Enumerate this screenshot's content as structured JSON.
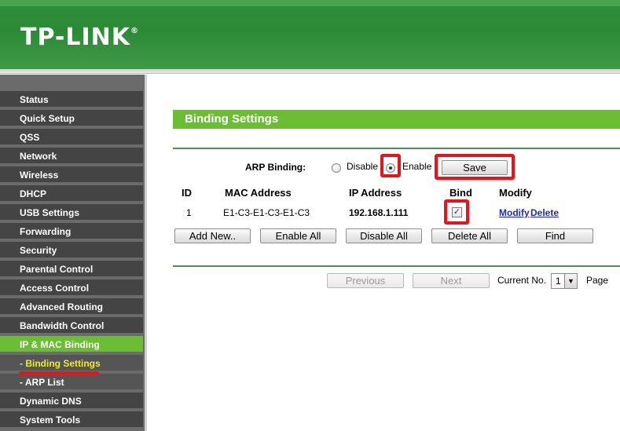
{
  "header": {
    "logo_text": "TP-LINK",
    "logo_mark": "®"
  },
  "sidebar": {
    "items": [
      {
        "label": "Status"
      },
      {
        "label": "Quick Setup"
      },
      {
        "label": "QSS"
      },
      {
        "label": "Network"
      },
      {
        "label": "Wireless"
      },
      {
        "label": "DHCP"
      },
      {
        "label": "USB Settings"
      },
      {
        "label": "Forwarding"
      },
      {
        "label": "Security"
      },
      {
        "label": "Parental Control"
      },
      {
        "label": "Access Control"
      },
      {
        "label": "Advanced Routing"
      },
      {
        "label": "Bandwidth Control"
      },
      {
        "label": "IP & MAC Binding"
      },
      {
        "label": "- Binding Settings"
      },
      {
        "label": "- ARP List"
      },
      {
        "label": "Dynamic DNS"
      },
      {
        "label": "System Tools"
      }
    ]
  },
  "page": {
    "title": "Binding Settings",
    "arp_binding_label": "ARP Binding:",
    "disable_label": "Disable",
    "enable_label": "Enable",
    "save_label": "Save",
    "table": {
      "headers": {
        "id": "ID",
        "mac": "MAC Address",
        "ip": "IP Address",
        "bind": "Bind",
        "modify": "Modify"
      },
      "rows": [
        {
          "id": "1",
          "mac": "E1-C3-E1-C3-E1-C3",
          "ip": "192.168.1.111",
          "bind_check": "✓",
          "modify": "Modify",
          "delete": "Delete"
        }
      ]
    },
    "buttons": {
      "add_new": "Add New..",
      "enable_all": "Enable All",
      "disable_all": "Disable All",
      "delete_all": "Delete All",
      "find": "Find"
    },
    "pagination": {
      "previous": "Previous",
      "next": "Next",
      "current_no_label": "Current No.",
      "current_no_value": "1",
      "page_label": "Page"
    }
  },
  "colors": {
    "green_accent": "#6cbd36",
    "header_green": "#2c8a36",
    "annotation_red": "#e8141d",
    "subitem_yellow": "#f2ea2a"
  }
}
